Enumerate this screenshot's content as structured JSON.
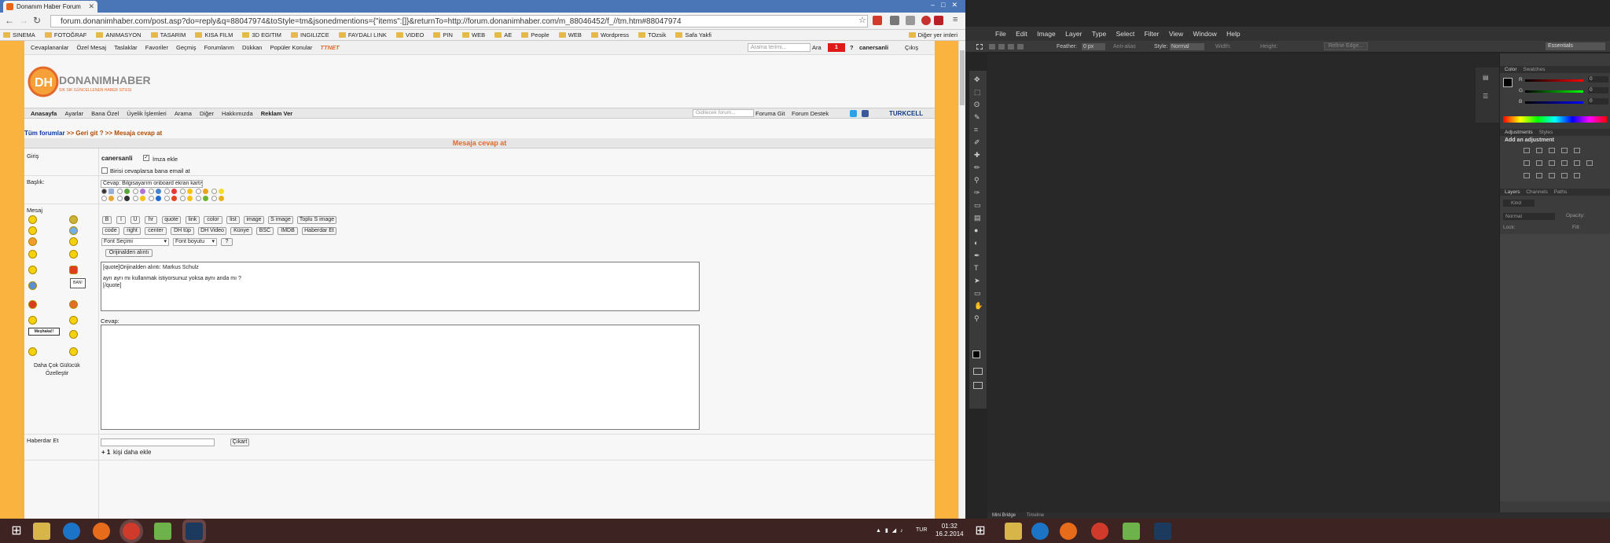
{
  "browser": {
    "tab_title": "Donanım Haber Forum",
    "url": "forum.donanimhaber.com/post.asp?do=reply&q=88047974&toStyle=tm&jsonedmentions={\"items\":[]}&returnTo=http://forum.donanimhaber.com/m_88046452/f_//tm.htm#88047974",
    "bookmarks": [
      "SINEMA",
      "FOTOĞRAF",
      "ANIMASYON",
      "TASARIM",
      "KISA FILM",
      "3D EGITIM",
      "INGILIZCE",
      "FAYDALI LINK",
      "VIDEO",
      "PIN",
      "WEB",
      "AE",
      "People",
      "WEB",
      "Wordpress",
      "TOzsik",
      "Safa Yakfi"
    ],
    "other_bookmarks": "Diğer yer imleri"
  },
  "forum": {
    "topbar": [
      "Cevaplananlar",
      "Özel Mesaj",
      "Taslaklar",
      "Favoriler",
      "Geçmiş",
      "Forumlarım",
      "Dükkan",
      "Popüler Konular"
    ],
    "search_placeholder": "Arama terimi...",
    "search_button": "Ara",
    "msg_count": "1",
    "help": "?",
    "username": "canersanli",
    "logout": "Çıkış",
    "logo_text": "DONANIMHABER",
    "logo_tagline": "SIK SIK GÜNCELLENEN HABER SITESI",
    "nav": [
      "Anasayfa",
      "Ayarlar",
      "Bana Özel",
      "Üyelik İşlemleri",
      "Arama",
      "Diğer",
      "Hakkımızda",
      "Reklam Ver"
    ],
    "nav_search_placeholder": "Gidilecek forum...",
    "goto_forum": "Foruma Git",
    "forum_destek": "Forum Destek",
    "sponsor": "TURKCELL",
    "breadcrumb_all": "Tüm forumlar",
    "breadcrumb_back": ">> Geri git ?",
    "breadcrumb_current": ">> Mesaja cevap at",
    "form_title": "Mesaja cevap at",
    "labels": {
      "giris": "Giriş",
      "baslik": "Başlık:",
      "mesaj": "Mesaj",
      "haberdar": "Haberdar Et"
    },
    "login_user": "canersanli",
    "imza_ekle": "İmza ekle",
    "email_notify": "Birisi cevaplarsa bana email at",
    "subject_value": "Cevap:  Bilgisayarım onboard ekran kartıyla",
    "toolbar_row1": [
      "B",
      "I",
      "U",
      "hr",
      "quote",
      "link",
      "color",
      "list",
      "image",
      "S image",
      "Toplu S image"
    ],
    "toolbar_row2": [
      "code",
      "right",
      "center",
      "DH tüp",
      "DH Video",
      "Künye",
      "BSC",
      "IMDB",
      "Haberdar Et"
    ],
    "font_select": "Font Seçimi",
    "font_size": "Font boyutu",
    "font_help": "?",
    "quote_original": "Orijinalden alıntı",
    "quote_line1": "[quote]Orijinalden alıntı:  Markus Schulz",
    "quote_line2": "ayrı ayrı mı kullanmak istiyorsunuz yoksa aynı anda mı ?",
    "quote_line3": "[/quote]",
    "cevap_label": "Cevap:",
    "more_smileys": "Daha Çok Gülücük",
    "customize": "Özelleştir",
    "remove": "Çıkart",
    "add_more_count": "+ 1",
    "add_more_text": "kişi daha ekle"
  },
  "photoshop": {
    "menu": [
      "File",
      "Edit",
      "Image",
      "Layer",
      "Type",
      "Select",
      "Filter",
      "View",
      "Window",
      "Help"
    ],
    "options": [
      "Feather:",
      "0 px",
      "Anti-alias",
      "Style:",
      "Normal",
      "Width:",
      "Height:",
      "Refine Edge..."
    ],
    "workspace": "Essentials",
    "panel_color_tabs": [
      "Color",
      "Swatches"
    ],
    "panel_adjust_tabs": [
      "Adjustments",
      "Styles"
    ],
    "add_adjustment": "Add an adjustment",
    "panel_layers_tabs": [
      "Layers",
      "Channels",
      "Paths"
    ],
    "layers_kind": "Kind",
    "layers_blend": "Normal",
    "opacity": "Opacity:",
    "lock": "Lock:",
    "fill": "Fill:",
    "bottom_tabs": [
      "Mini Bridge",
      "Timeline"
    ],
    "rgb": [
      "R",
      "G",
      "B"
    ],
    "rgb_values": [
      "0",
      "0",
      "0"
    ]
  },
  "taskbar": {
    "lang": "TUR",
    "time": "01:32",
    "date": "16.2.2014"
  }
}
